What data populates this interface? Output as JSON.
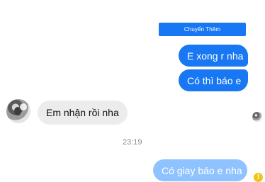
{
  "app": {
    "top_action_label": "Chuyển Thêm"
  },
  "messages": {
    "sent_1": "E xong r nha",
    "sent_2": "Có thì báo e",
    "received_1": "Em nhận rồi nha",
    "sent_3": "Có giay báo e nha"
  },
  "meta": {
    "timestamp": "23:19"
  },
  "icons": {
    "warning": "warning-icon",
    "avatar": "avatar"
  },
  "colors": {
    "sent_bubble": "#1877f2",
    "sent_bubble_soft": "#8ec3ff",
    "received_bubble": "#ececec",
    "warning": "#f0c419"
  }
}
